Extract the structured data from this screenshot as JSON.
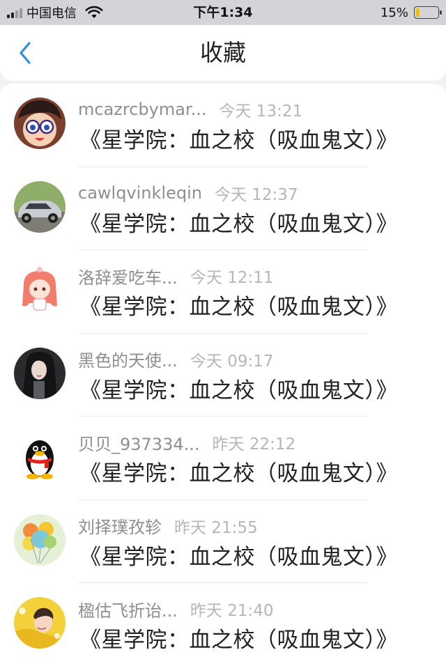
{
  "status_bar": {
    "carrier": "中国电信",
    "time": "下午1:34",
    "battery_percent": "15%",
    "battery_level": 0.15,
    "icons": [
      "signal-icon",
      "wifi-icon",
      "battery-icon"
    ]
  },
  "nav": {
    "back_icon": "chevron-left-icon",
    "title": "收藏"
  },
  "colors": {
    "accent": "#2b8ce0",
    "status_bar_bg": "#d4d4d8",
    "battery": "#f5c000"
  },
  "favorites": [
    {
      "username": "mcazrcbymar...",
      "time": "今天 13:21",
      "book": "《星学院：血之校（吸血鬼文）》",
      "avatar": "anime-boy-glasses"
    },
    {
      "username": "cawlqvinkleqin",
      "time": "今天 12:37",
      "book": "《星学院：血之校（吸血鬼文）》",
      "avatar": "silver-car"
    },
    {
      "username": "洛辞爱吃车...",
      "time": "今天 12:11",
      "book": "《星学院：血之校（吸血鬼文）》",
      "avatar": "anime-girl-pink-hair"
    },
    {
      "username": "黑色的天使...",
      "time": "今天 09:17",
      "book": "《星学院：血之校（吸血鬼文）》",
      "avatar": "dark-girl"
    },
    {
      "username": "贝贝_937334...",
      "time": "昨天 22:12",
      "book": "《星学院：血之校（吸血鬼文）》",
      "avatar": "qq-penguin"
    },
    {
      "username": "刘择璞孜轸",
      "time": "昨天 21:55",
      "book": "《星学院：血之校（吸血鬼文）》",
      "avatar": "balloons"
    },
    {
      "username": "楹估飞折诒...",
      "time": "昨天 21:40",
      "book": "《星学院：血之校（吸血鬼文）》",
      "avatar": "yellow-portrait"
    }
  ]
}
